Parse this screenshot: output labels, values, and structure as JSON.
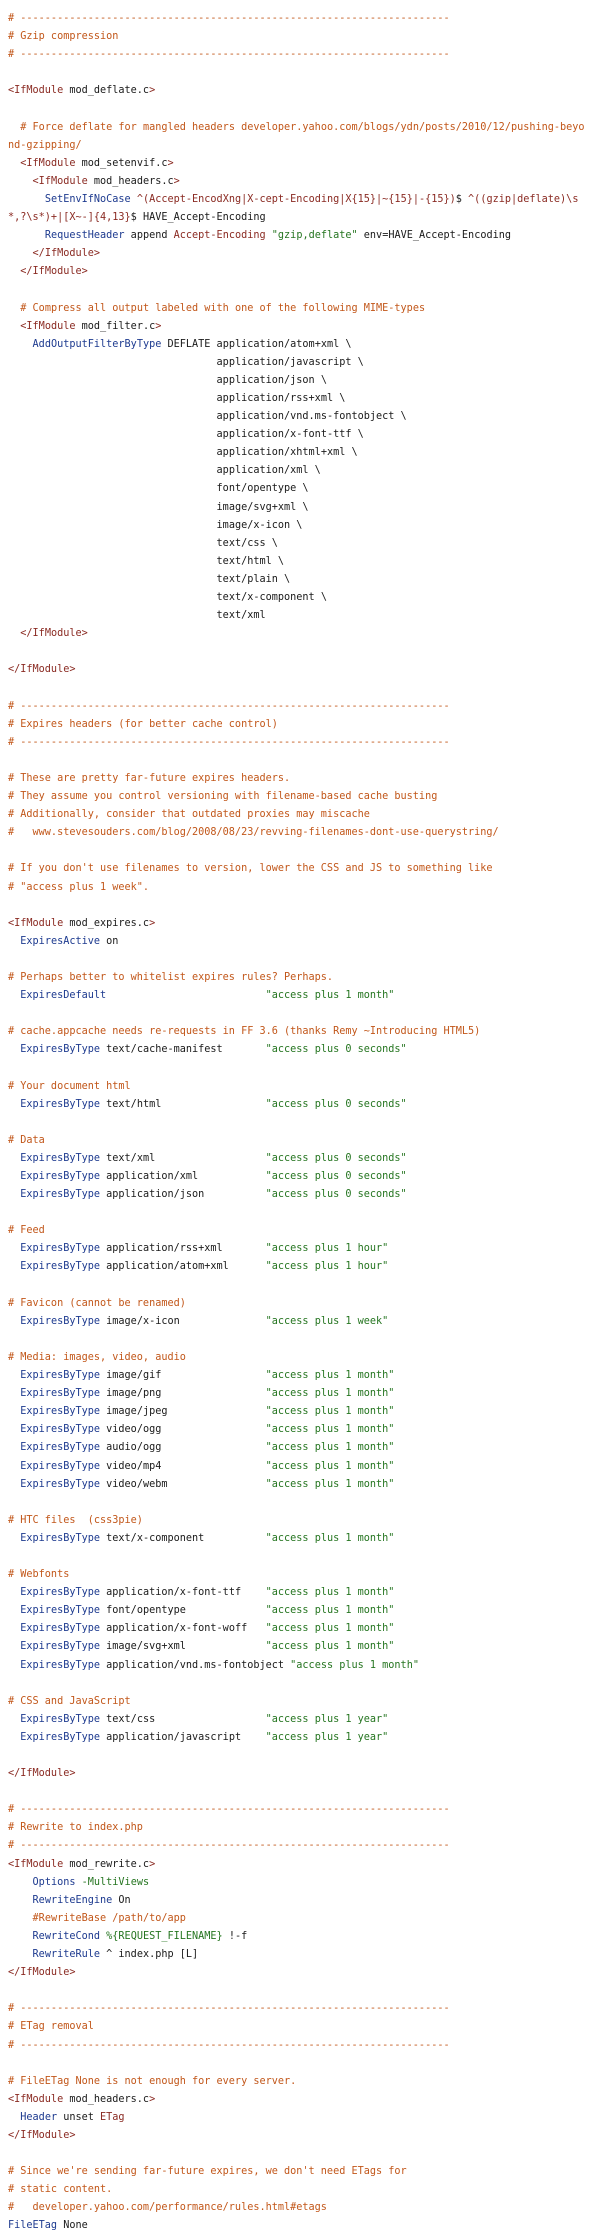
{
  "file_content": {
    "colors": {
      "comment": "#c2571a",
      "directive": "#1d3a8f",
      "tag": "#8a2a22",
      "string": "#257520",
      "plain": "#1a1a1a",
      "background": "#ffffff"
    },
    "lines": [
      [
        [
          "c",
          "# ----------------------------------------------------------------------"
        ]
      ],
      [
        [
          "c",
          "# Gzip compression"
        ]
      ],
      [
        [
          "c",
          "# ----------------------------------------------------------------------"
        ]
      ],
      [],
      [
        [
          "t",
          "<IfModule"
        ],
        [
          "p",
          " mod_deflate.c"
        ],
        [
          "t",
          ">"
        ]
      ],
      [],
      [
        [
          "c",
          "  # Force deflate for mangled headers developer.yahoo.com/blogs/ydn/posts/2010/12/pushing-beyond-gzipping/"
        ]
      ],
      [
        [
          "p",
          "  "
        ],
        [
          "t",
          "<IfModule"
        ],
        [
          "p",
          " mod_setenvif.c"
        ],
        [
          "t",
          ">"
        ]
      ],
      [
        [
          "p",
          "    "
        ],
        [
          "t",
          "<IfModule"
        ],
        [
          "p",
          " mod_headers.c"
        ],
        [
          "t",
          ">"
        ]
      ],
      [
        [
          "p",
          "      "
        ],
        [
          "k",
          "SetEnvIfNoCase"
        ],
        [
          "p",
          " "
        ],
        [
          "t",
          "^(Accept-EncodXng|X-cept-Encoding|X{15}|~{15}|-{15})"
        ],
        [
          "p",
          "$ "
        ],
        [
          "t",
          "^((gzip|deflate)\\s*,?\\s*)+|[X~-]{4,13}"
        ],
        [
          "p",
          "$ HAVE_Accept-Encoding"
        ]
      ],
      [
        [
          "p",
          "      "
        ],
        [
          "k",
          "RequestHeader"
        ],
        [
          "p",
          " append "
        ],
        [
          "t",
          "Accept-Encoding"
        ],
        [
          "p",
          " "
        ],
        [
          "s",
          "\"gzip,deflate\""
        ],
        [
          "p",
          " env=HAVE_Accept-Encoding"
        ]
      ],
      [
        [
          "p",
          "    "
        ],
        [
          "t",
          "</IfModule>"
        ]
      ],
      [
        [
          "p",
          "  "
        ],
        [
          "t",
          "</IfModule>"
        ]
      ],
      [],
      [
        [
          "c",
          "  # Compress all output labeled with one of the following MIME-types"
        ]
      ],
      [
        [
          "p",
          "  "
        ],
        [
          "t",
          "<IfModule"
        ],
        [
          "p",
          " mod_filter.c"
        ],
        [
          "t",
          ">"
        ]
      ],
      [
        [
          "p",
          "    "
        ],
        [
          "k",
          "AddOutputFilterByType"
        ],
        [
          "p",
          " DEFLATE application/atom+xml \\"
        ]
      ],
      [
        [
          "p",
          "                                  application/javascript \\"
        ]
      ],
      [
        [
          "p",
          "                                  application/json \\"
        ]
      ],
      [
        [
          "p",
          "                                  application/rss+xml \\"
        ]
      ],
      [
        [
          "p",
          "                                  application/vnd.ms-fontobject \\"
        ]
      ],
      [
        [
          "p",
          "                                  application/x-font-ttf \\"
        ]
      ],
      [
        [
          "p",
          "                                  application/xhtml+xml \\"
        ]
      ],
      [
        [
          "p",
          "                                  application/xml \\"
        ]
      ],
      [
        [
          "p",
          "                                  font/opentype \\"
        ]
      ],
      [
        [
          "p",
          "                                  image/svg+xml \\"
        ]
      ],
      [
        [
          "p",
          "                                  image/x-icon \\"
        ]
      ],
      [
        [
          "p",
          "                                  text/css \\"
        ]
      ],
      [
        [
          "p",
          "                                  text/html \\"
        ]
      ],
      [
        [
          "p",
          "                                  text/plain \\"
        ]
      ],
      [
        [
          "p",
          "                                  text/x-component \\"
        ]
      ],
      [
        [
          "p",
          "                                  text/xml"
        ]
      ],
      [
        [
          "p",
          "  "
        ],
        [
          "t",
          "</IfModule>"
        ]
      ],
      [],
      [
        [
          "t",
          "</IfModule>"
        ]
      ],
      [],
      [
        [
          "c",
          "# ----------------------------------------------------------------------"
        ]
      ],
      [
        [
          "c",
          "# Expires headers (for better cache control)"
        ]
      ],
      [
        [
          "c",
          "# ----------------------------------------------------------------------"
        ]
      ],
      [],
      [
        [
          "c",
          "# These are pretty far-future expires headers."
        ]
      ],
      [
        [
          "c",
          "# They assume you control versioning with filename-based cache busting"
        ]
      ],
      [
        [
          "c",
          "# Additionally, consider that outdated proxies may miscache"
        ]
      ],
      [
        [
          "c",
          "#   www.stevesouders.com/blog/2008/08/23/revving-filenames-dont-use-querystring/"
        ]
      ],
      [],
      [
        [
          "c",
          "# If you don't use filenames to version, lower the CSS and JS to something like"
        ]
      ],
      [
        [
          "c",
          "# \"access plus 1 week\"."
        ]
      ],
      [],
      [
        [
          "t",
          "<IfModule"
        ],
        [
          "p",
          " mod_expires.c"
        ],
        [
          "t",
          ">"
        ]
      ],
      [
        [
          "p",
          "  "
        ],
        [
          "k",
          "ExpiresActive"
        ],
        [
          "p",
          " on"
        ]
      ],
      [],
      [
        [
          "c",
          "# Perhaps better to whitelist expires rules? Perhaps."
        ]
      ],
      [
        [
          "p",
          "  "
        ],
        [
          "k",
          "ExpiresDefault"
        ],
        [
          "p",
          "                          "
        ],
        [
          "s",
          "\"access plus 1 month\""
        ]
      ],
      [],
      [
        [
          "c",
          "# cache.appcache needs re-requests in FF 3.6 (thanks Remy ~Introducing HTML5)"
        ]
      ],
      [
        [
          "p",
          "  "
        ],
        [
          "k",
          "ExpiresByType"
        ],
        [
          "p",
          " text/cache-manifest       "
        ],
        [
          "s",
          "\"access plus 0 seconds\""
        ]
      ],
      [],
      [
        [
          "c",
          "# Your document html"
        ]
      ],
      [
        [
          "p",
          "  "
        ],
        [
          "k",
          "ExpiresByType"
        ],
        [
          "p",
          " text/html                 "
        ],
        [
          "s",
          "\"access plus 0 seconds\""
        ]
      ],
      [],
      [
        [
          "c",
          "# Data"
        ]
      ],
      [
        [
          "p",
          "  "
        ],
        [
          "k",
          "ExpiresByType"
        ],
        [
          "p",
          " text/xml                  "
        ],
        [
          "s",
          "\"access plus 0 seconds\""
        ]
      ],
      [
        [
          "p",
          "  "
        ],
        [
          "k",
          "ExpiresByType"
        ],
        [
          "p",
          " application/xml           "
        ],
        [
          "s",
          "\"access plus 0 seconds\""
        ]
      ],
      [
        [
          "p",
          "  "
        ],
        [
          "k",
          "ExpiresByType"
        ],
        [
          "p",
          " application/json          "
        ],
        [
          "s",
          "\"access plus 0 seconds\""
        ]
      ],
      [],
      [
        [
          "c",
          "# Feed"
        ]
      ],
      [
        [
          "p",
          "  "
        ],
        [
          "k",
          "ExpiresByType"
        ],
        [
          "p",
          " application/rss+xml       "
        ],
        [
          "s",
          "\"access plus 1 hour\""
        ]
      ],
      [
        [
          "p",
          "  "
        ],
        [
          "k",
          "ExpiresByType"
        ],
        [
          "p",
          " application/atom+xml      "
        ],
        [
          "s",
          "\"access plus 1 hour\""
        ]
      ],
      [],
      [
        [
          "c",
          "# Favicon (cannot be renamed)"
        ]
      ],
      [
        [
          "p",
          "  "
        ],
        [
          "k",
          "ExpiresByType"
        ],
        [
          "p",
          " image/x-icon              "
        ],
        [
          "s",
          "\"access plus 1 week\""
        ]
      ],
      [],
      [
        [
          "c",
          "# Media: images, video, audio"
        ]
      ],
      [
        [
          "p",
          "  "
        ],
        [
          "k",
          "ExpiresByType"
        ],
        [
          "p",
          " image/gif                 "
        ],
        [
          "s",
          "\"access plus 1 month\""
        ]
      ],
      [
        [
          "p",
          "  "
        ],
        [
          "k",
          "ExpiresByType"
        ],
        [
          "p",
          " image/png                 "
        ],
        [
          "s",
          "\"access plus 1 month\""
        ]
      ],
      [
        [
          "p",
          "  "
        ],
        [
          "k",
          "ExpiresByType"
        ],
        [
          "p",
          " image/jpeg                "
        ],
        [
          "s",
          "\"access plus 1 month\""
        ]
      ],
      [
        [
          "p",
          "  "
        ],
        [
          "k",
          "ExpiresByType"
        ],
        [
          "p",
          " video/ogg                 "
        ],
        [
          "s",
          "\"access plus 1 month\""
        ]
      ],
      [
        [
          "p",
          "  "
        ],
        [
          "k",
          "ExpiresByType"
        ],
        [
          "p",
          " audio/ogg                 "
        ],
        [
          "s",
          "\"access plus 1 month\""
        ]
      ],
      [
        [
          "p",
          "  "
        ],
        [
          "k",
          "ExpiresByType"
        ],
        [
          "p",
          " video/mp4                 "
        ],
        [
          "s",
          "\"access plus 1 month\""
        ]
      ],
      [
        [
          "p",
          "  "
        ],
        [
          "k",
          "ExpiresByType"
        ],
        [
          "p",
          " video/webm                "
        ],
        [
          "s",
          "\"access plus 1 month\""
        ]
      ],
      [],
      [
        [
          "c",
          "# HTC files  (css3pie)"
        ]
      ],
      [
        [
          "p",
          "  "
        ],
        [
          "k",
          "ExpiresByType"
        ],
        [
          "p",
          " text/x-component          "
        ],
        [
          "s",
          "\"access plus 1 month\""
        ]
      ],
      [],
      [
        [
          "c",
          "# Webfonts"
        ]
      ],
      [
        [
          "p",
          "  "
        ],
        [
          "k",
          "ExpiresByType"
        ],
        [
          "p",
          " application/x-font-ttf    "
        ],
        [
          "s",
          "\"access plus 1 month\""
        ]
      ],
      [
        [
          "p",
          "  "
        ],
        [
          "k",
          "ExpiresByType"
        ],
        [
          "p",
          " font/opentype             "
        ],
        [
          "s",
          "\"access plus 1 month\""
        ]
      ],
      [
        [
          "p",
          "  "
        ],
        [
          "k",
          "ExpiresByType"
        ],
        [
          "p",
          " application/x-font-woff   "
        ],
        [
          "s",
          "\"access plus 1 month\""
        ]
      ],
      [
        [
          "p",
          "  "
        ],
        [
          "k",
          "ExpiresByType"
        ],
        [
          "p",
          " image/svg+xml             "
        ],
        [
          "s",
          "\"access plus 1 month\""
        ]
      ],
      [
        [
          "p",
          "  "
        ],
        [
          "k",
          "ExpiresByType"
        ],
        [
          "p",
          " application/vnd.ms-fontobject "
        ],
        [
          "s",
          "\"access plus 1 month\""
        ]
      ],
      [],
      [
        [
          "c",
          "# CSS and JavaScript"
        ]
      ],
      [
        [
          "p",
          "  "
        ],
        [
          "k",
          "ExpiresByType"
        ],
        [
          "p",
          " text/css                  "
        ],
        [
          "s",
          "\"access plus 1 year\""
        ]
      ],
      [
        [
          "p",
          "  "
        ],
        [
          "k",
          "ExpiresByType"
        ],
        [
          "p",
          " application/javascript    "
        ],
        [
          "s",
          "\"access plus 1 year\""
        ]
      ],
      [],
      [
        [
          "t",
          "</IfModule>"
        ]
      ],
      [],
      [
        [
          "c",
          "# ----------------------------------------------------------------------"
        ]
      ],
      [
        [
          "c",
          "# Rewrite to index.php"
        ]
      ],
      [
        [
          "c",
          "# ----------------------------------------------------------------------"
        ]
      ],
      [
        [
          "t",
          "<IfModule"
        ],
        [
          "p",
          " mod_rewrite.c"
        ],
        [
          "t",
          ">"
        ]
      ],
      [
        [
          "p",
          "    "
        ],
        [
          "k",
          "Options"
        ],
        [
          "p",
          " "
        ],
        [
          "s",
          "-MultiViews"
        ]
      ],
      [
        [
          "p",
          "    "
        ],
        [
          "k",
          "RewriteEngine"
        ],
        [
          "p",
          " On"
        ]
      ],
      [
        [
          "c",
          "    #RewriteBase /path/to/app"
        ]
      ],
      [
        [
          "p",
          "    "
        ],
        [
          "k",
          "RewriteCond"
        ],
        [
          "p",
          " "
        ],
        [
          "s",
          "%{REQUEST_FILENAME}"
        ],
        [
          "p",
          " !-f"
        ]
      ],
      [
        [
          "p",
          "    "
        ],
        [
          "k",
          "RewriteRule"
        ],
        [
          "p",
          " ^ index.php [L]"
        ]
      ],
      [
        [
          "t",
          "</IfModule>"
        ]
      ],
      [],
      [
        [
          "c",
          "# ----------------------------------------------------------------------"
        ]
      ],
      [
        [
          "c",
          "# ETag removal"
        ]
      ],
      [
        [
          "c",
          "# ----------------------------------------------------------------------"
        ]
      ],
      [],
      [
        [
          "c",
          "# FileETag None is not enough for every server."
        ]
      ],
      [
        [
          "t",
          "<IfModule"
        ],
        [
          "p",
          " mod_headers.c"
        ],
        [
          "t",
          ">"
        ]
      ],
      [
        [
          "p",
          "  "
        ],
        [
          "k",
          "Header"
        ],
        [
          "p",
          " unset "
        ],
        [
          "t",
          "ETag"
        ]
      ],
      [
        [
          "t",
          "</IfModule>"
        ]
      ],
      [],
      [
        [
          "c",
          "# Since we're sending far-future expires, we don't need ETags for"
        ]
      ],
      [
        [
          "c",
          "# static content."
        ]
      ],
      [
        [
          "c",
          "#   developer.yahoo.com/performance/rules.html#etags"
        ]
      ],
      [
        [
          "k",
          "FileETag"
        ],
        [
          "p",
          " None"
        ]
      ]
    ]
  }
}
